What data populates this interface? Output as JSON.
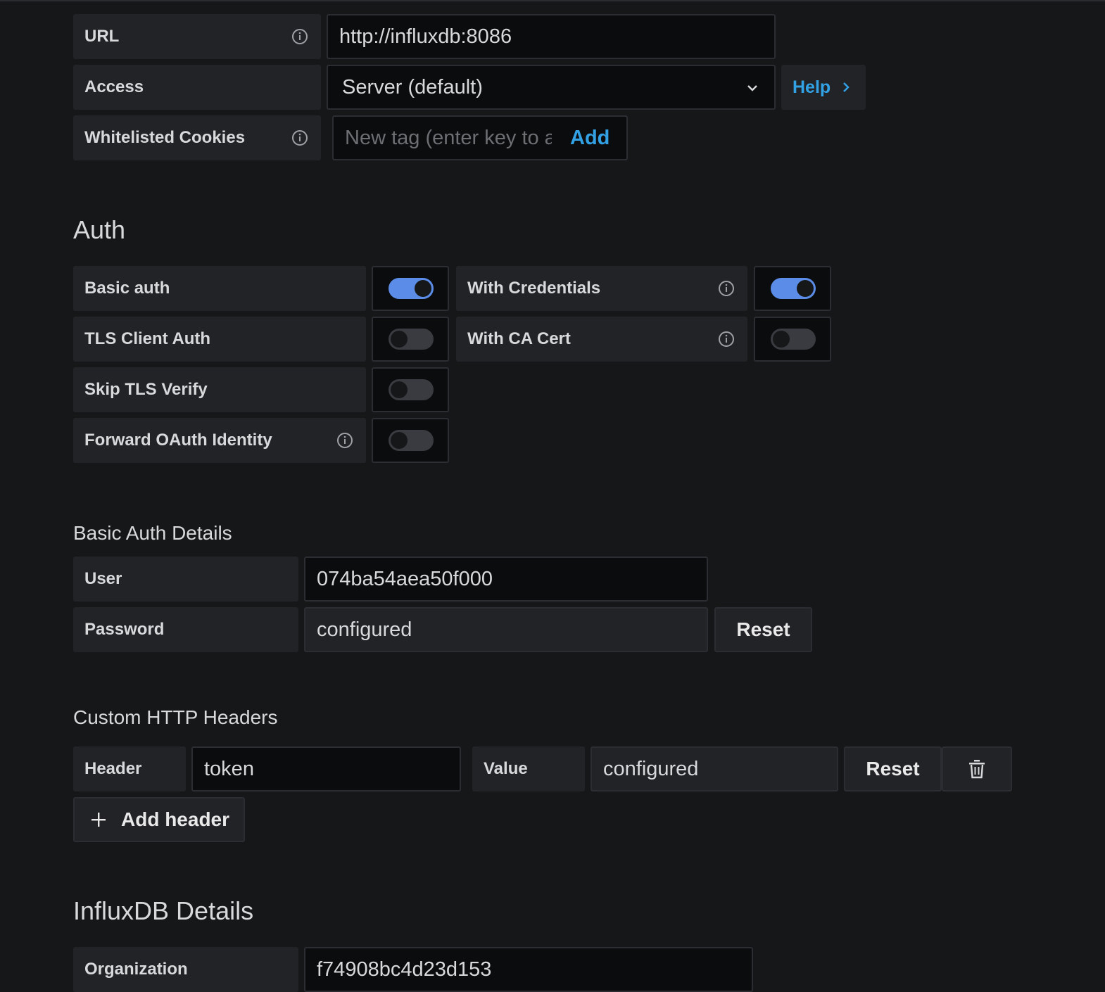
{
  "http": {
    "url_label": "URL",
    "url_value": "http://influxdb:8086",
    "access_label": "Access",
    "access_value": "Server (default)",
    "help_label": "Help",
    "cookies_label": "Whitelisted Cookies",
    "cookies_placeholder": "New tag (enter key to ac",
    "cookies_add": "Add"
  },
  "auth": {
    "title": "Auth",
    "basic_auth_label": "Basic auth",
    "basic_auth_on": true,
    "with_credentials_label": "With Credentials",
    "with_credentials_on": true,
    "tls_client_auth_label": "TLS Client Auth",
    "tls_client_auth_on": false,
    "with_ca_cert_label": "With CA Cert",
    "with_ca_cert_on": false,
    "skip_tls_label": "Skip TLS Verify",
    "skip_tls_on": false,
    "forward_oauth_label": "Forward OAuth Identity",
    "forward_oauth_on": false
  },
  "basic_auth_details": {
    "title": "Basic Auth Details",
    "user_label": "User",
    "user_value": "074ba54aea50f000",
    "password_label": "Password",
    "password_value": "configured",
    "reset_label": "Reset"
  },
  "custom_headers": {
    "title": "Custom HTTP Headers",
    "header_label": "Header",
    "header_value": "token",
    "value_label": "Value",
    "value_value": "configured",
    "reset_label": "Reset",
    "add_header_label": "Add header"
  },
  "influx": {
    "title": "InfluxDB Details",
    "org_label": "Organization",
    "org_value": "f74908bc4d23d153"
  },
  "colors": {
    "accent_blue": "#5b8de8",
    "link_blue": "#33a2e5",
    "background": "#161719",
    "label_bg": "#222327",
    "input_bg": "#0b0c0e"
  }
}
